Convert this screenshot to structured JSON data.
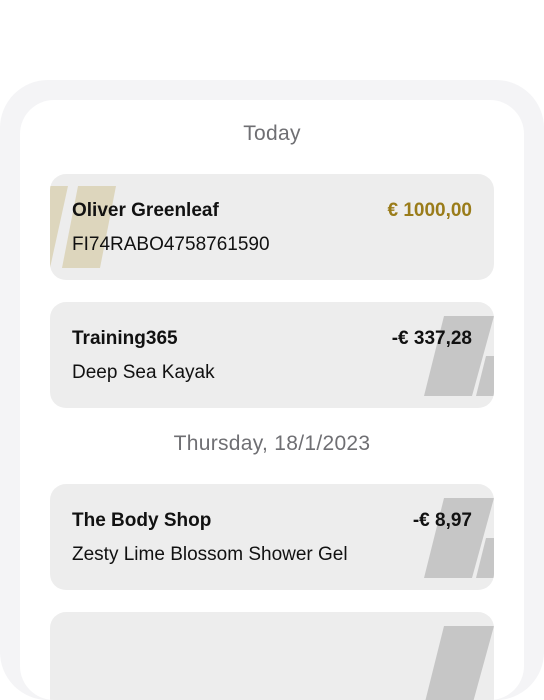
{
  "sections": [
    {
      "date": "Today",
      "transactions": [
        {
          "name": "Oliver Greenleaf",
          "detail": "FI74RABO4758761590",
          "amount": "€ 1000,00",
          "direction": "credit"
        },
        {
          "name": "Training365",
          "detail": "Deep Sea Kayak",
          "amount": "-€ 337,28",
          "direction": "debit"
        }
      ]
    },
    {
      "date": "Thursday, 18/1/2023",
      "transactions": [
        {
          "name": "The Body Shop",
          "detail": "Zesty Lime Blossom Shower Gel",
          "amount": "-€ 8,97",
          "direction": "debit"
        }
      ]
    }
  ],
  "colors": {
    "credit_amount": "#9a7c1a",
    "credit_stripe": "#ddd6bd",
    "debit_stripe": "#c6c6c6",
    "card_background": "#ededed",
    "date_header": "#6f6f73"
  }
}
